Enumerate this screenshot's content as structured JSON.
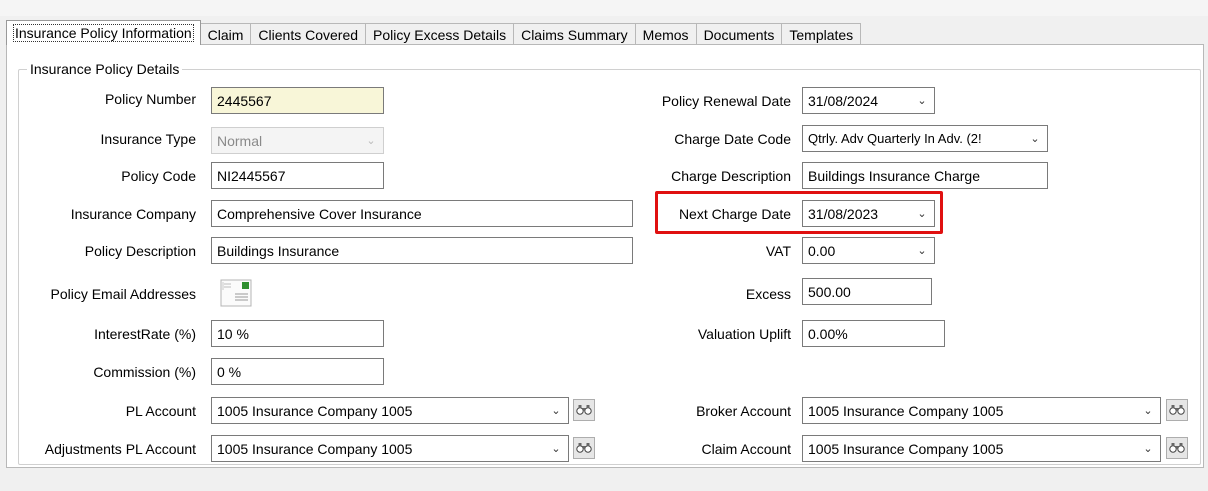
{
  "tabs": [
    {
      "label": "Insurance Policy Information",
      "active": true
    },
    {
      "label": "Claim"
    },
    {
      "label": "Clients Covered"
    },
    {
      "label": "Policy Excess Details"
    },
    {
      "label": "Claims Summary"
    },
    {
      "label": "Memos"
    },
    {
      "label": "Documents"
    },
    {
      "label": "Templates"
    }
  ],
  "group_title": "Insurance Policy Details",
  "left": {
    "policy_number": {
      "label": "Policy Number",
      "value": "2445567"
    },
    "insurance_type": {
      "label": "Insurance Type",
      "value": "Normal"
    },
    "policy_code": {
      "label": "Policy Code",
      "value": "NI2445567"
    },
    "insurance_company": {
      "label": "Insurance Company",
      "value": "Comprehensive Cover Insurance"
    },
    "policy_description": {
      "label": "Policy Description",
      "value": "Buildings Insurance"
    },
    "policy_email": {
      "label": "Policy Email Addresses",
      "icon": "envelope-icon"
    },
    "interest_rate": {
      "label": "InterestRate (%)",
      "value": "10 %"
    },
    "commission": {
      "label": "Commission (%)",
      "value": "0 %"
    },
    "pl_account": {
      "label": "PL Account",
      "value": "1005  Insurance Company 1005"
    },
    "adj_pl_account": {
      "label": "Adjustments PL Account",
      "value": "1005  Insurance Company 1005"
    }
  },
  "right": {
    "renewal_date": {
      "label": "Policy Renewal Date",
      "value": "31/08/2024"
    },
    "charge_date_code": {
      "label": "Charge Date Code",
      "value": "Qtrly. Adv  Quarterly In Adv. (2!"
    },
    "charge_description": {
      "label": "Charge Description",
      "value": "Buildings Insurance Charge"
    },
    "next_charge_date": {
      "label": "Next Charge Date",
      "value": "31/08/2023"
    },
    "vat": {
      "label": "VAT",
      "value": "0.00"
    },
    "excess": {
      "label": "Excess",
      "value": "500.00"
    },
    "valuation_uplift": {
      "label": "Valuation Uplift",
      "value": "0.00%"
    },
    "broker_account": {
      "label": "Broker Account",
      "value": "1005  Insurance Company 1005"
    },
    "claim_account": {
      "label": "Claim Account",
      "value": "1005  Insurance Company 1005"
    }
  },
  "colors": {
    "highlight": "#e01010",
    "policy_number_bg": "#f8f6d8"
  }
}
